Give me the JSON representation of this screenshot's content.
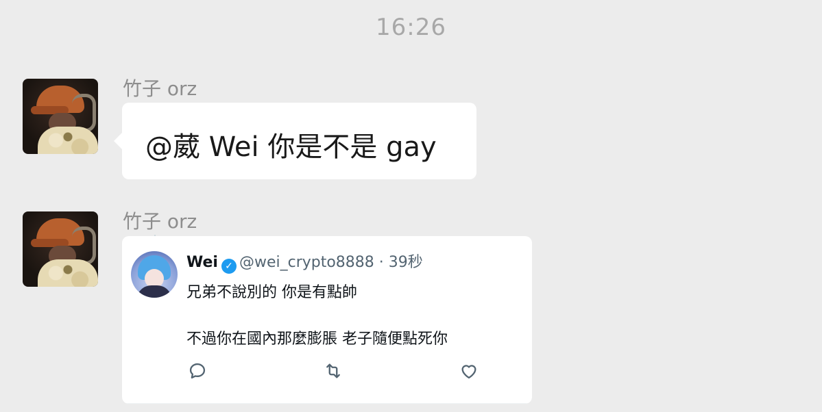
{
  "chat": {
    "timestamp": "16:26",
    "messages": [
      {
        "sender": "竹子 orz",
        "text": "@葳 Wei 你是不是 gay"
      },
      {
        "sender": "竹子 orz",
        "tweet": {
          "name": "Wei",
          "handle": "@wei_crypto8888",
          "separator": "·",
          "time": "39秒",
          "line1": "兄弟不說別的 你是有點帥",
          "line2": "不過你在國內那麼膨脹 老子隨便點死你",
          "icons": {
            "reply": "reply-icon",
            "retweet": "retweet-icon",
            "like": "like-icon"
          }
        }
      }
    ]
  },
  "colors": {
    "background": "#ececec",
    "bubble": "#ffffff",
    "verified": "#1d9bf0",
    "secondary_text": "#536471"
  }
}
